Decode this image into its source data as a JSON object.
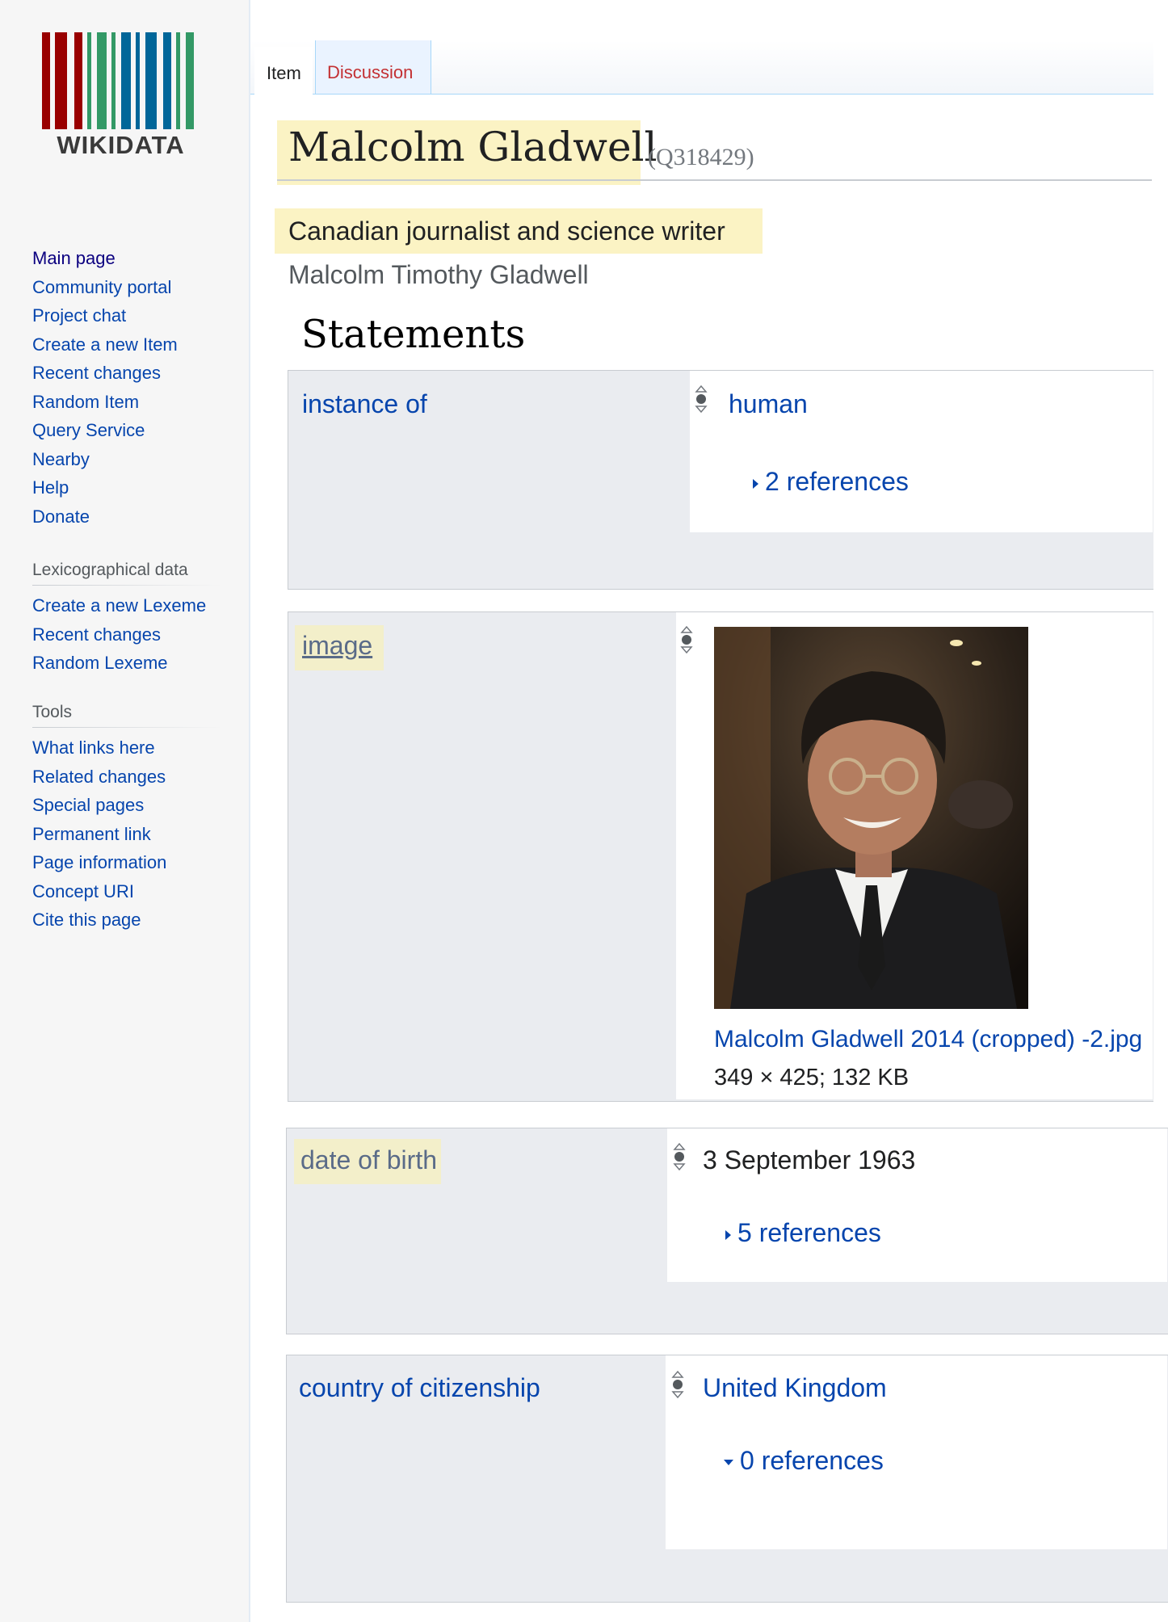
{
  "logo": {
    "text": "WIKIDATA",
    "bar_colors": [
      "#990000",
      "#339966",
      "#006699"
    ]
  },
  "sidebar": {
    "main_links": [
      "Main page",
      "Community portal",
      "Project chat",
      "Create a new Item",
      "Recent changes",
      "Random Item",
      "Query Service",
      "Nearby",
      "Help",
      "Donate"
    ],
    "lexico_heading": "Lexicographical data",
    "lexico_links": [
      "Create a new Lexeme",
      "Recent changes",
      "Random Lexeme"
    ],
    "tools_heading": "Tools",
    "tools_links": [
      "What links here",
      "Related changes",
      "Special pages",
      "Permanent link",
      "Page information",
      "Concept URI",
      "Cite this page"
    ]
  },
  "tabs": {
    "item": "Item",
    "discussion": "Discussion"
  },
  "entity": {
    "label": "Malcolm Gladwell",
    "id": "(Q318429)",
    "description": "Canadian journalist and science writer",
    "alias": "Malcolm Timothy Gladwell"
  },
  "statements_heading": "Statements",
  "statements": {
    "instance_of": {
      "property": "instance of",
      "value": "human",
      "references": "2 references"
    },
    "image": {
      "property": "image",
      "file": "Malcolm Gladwell 2014 (cropped) -2.jpg",
      "meta": "349 × 425; 132 KB"
    },
    "date_of_birth": {
      "property": "date of birth",
      "value": "3 September 1963",
      "references": "5 references"
    },
    "citizenship": {
      "property": "country of citizenship",
      "value": "United Kingdom",
      "references": "0 references"
    }
  },
  "colors": {
    "link": "#0645ad",
    "highlight": "#fbf3c4",
    "group_bg": "#eaecf0"
  }
}
